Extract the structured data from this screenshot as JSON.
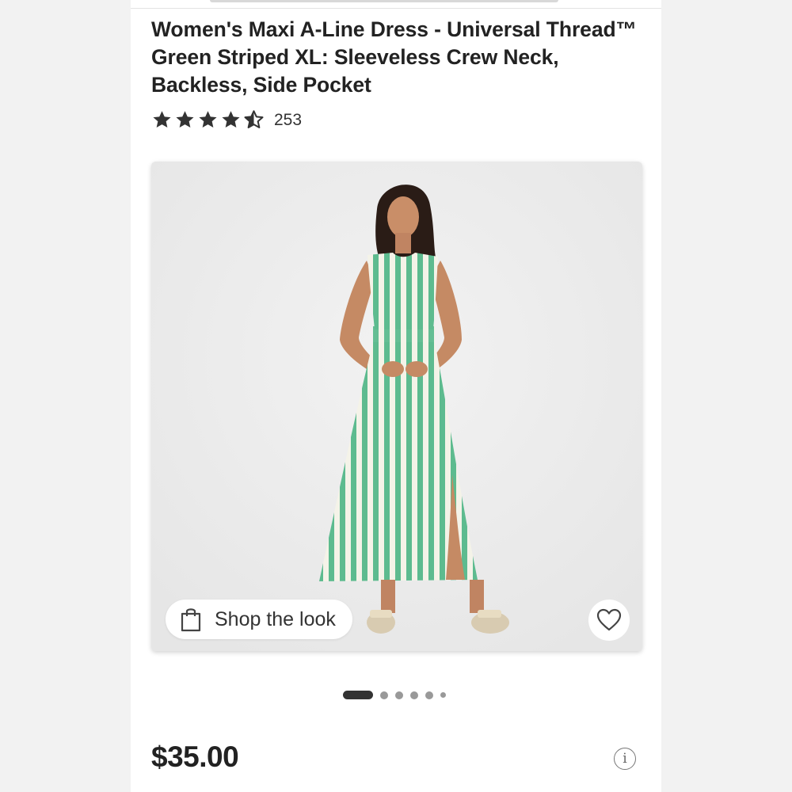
{
  "product": {
    "title": "Women's Maxi A-Line Dress - Universal Thread™ Green Striped XL: Sleeveless Crew Neck, Backless, Side Pocket",
    "rating": 4.5,
    "review_count": "253",
    "price": "$35.00"
  },
  "gallery": {
    "shop_the_look_label": "Shop the look",
    "image_count": 6,
    "active_index": 0
  },
  "icons": {
    "star": "star-icon",
    "bag": "shopping-bag-icon",
    "favorite": "heart-icon",
    "info": "info-icon"
  },
  "colors": {
    "dress_green": "#5dbb8f",
    "dress_cream": "#f4f3e8",
    "text_dark": "#222222",
    "background": "#ececec"
  }
}
